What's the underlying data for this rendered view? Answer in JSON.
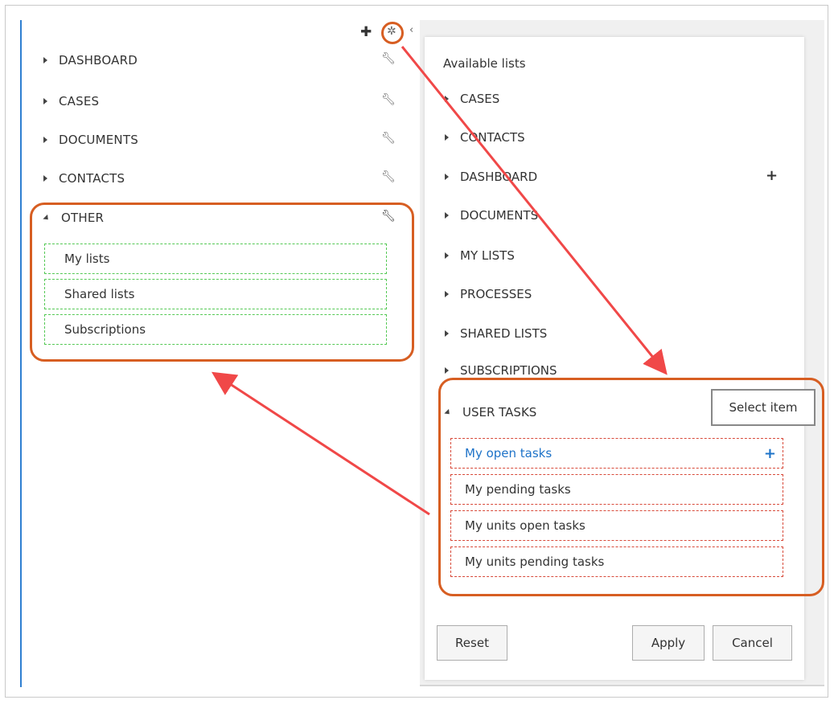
{
  "left_panel": {
    "items": [
      {
        "label": "DASHBOARD"
      },
      {
        "label": "CASES"
      },
      {
        "label": "DOCUMENTS"
      },
      {
        "label": "CONTACTS"
      },
      {
        "label": "OTHER"
      }
    ],
    "other_children": [
      {
        "label": "My lists"
      },
      {
        "label": "Shared lists"
      },
      {
        "label": "Subscriptions"
      }
    ],
    "icons": {
      "add": "plus-icon",
      "settings": "gear-icon",
      "collapse": "chevron-left-icon",
      "configure": "wrench-icon"
    }
  },
  "dialog": {
    "title": "Available lists",
    "lists": [
      {
        "label": "CASES"
      },
      {
        "label": "CONTACTS"
      },
      {
        "label": "DASHBOARD"
      },
      {
        "label": "DOCUMENTS"
      },
      {
        "label": "MY LISTS"
      },
      {
        "label": "PROCESSES"
      },
      {
        "label": "SHARED LISTS"
      },
      {
        "label": "SUBSCRIPTIONS"
      },
      {
        "label": "USER TASKS"
      }
    ],
    "user_tasks": [
      {
        "label": "My open tasks"
      },
      {
        "label": "My pending tasks"
      },
      {
        "label": "My units open tasks"
      },
      {
        "label": "My units pending tasks"
      }
    ],
    "tooltip": "Select item",
    "buttons": {
      "reset": "Reset",
      "apply": "Apply",
      "cancel": "Cancel"
    }
  },
  "colors": {
    "highlight": "#d75e22",
    "arrow": "#f04848",
    "selected_text": "#1e73c8",
    "sidebar_accent": "#2f7fd1"
  }
}
